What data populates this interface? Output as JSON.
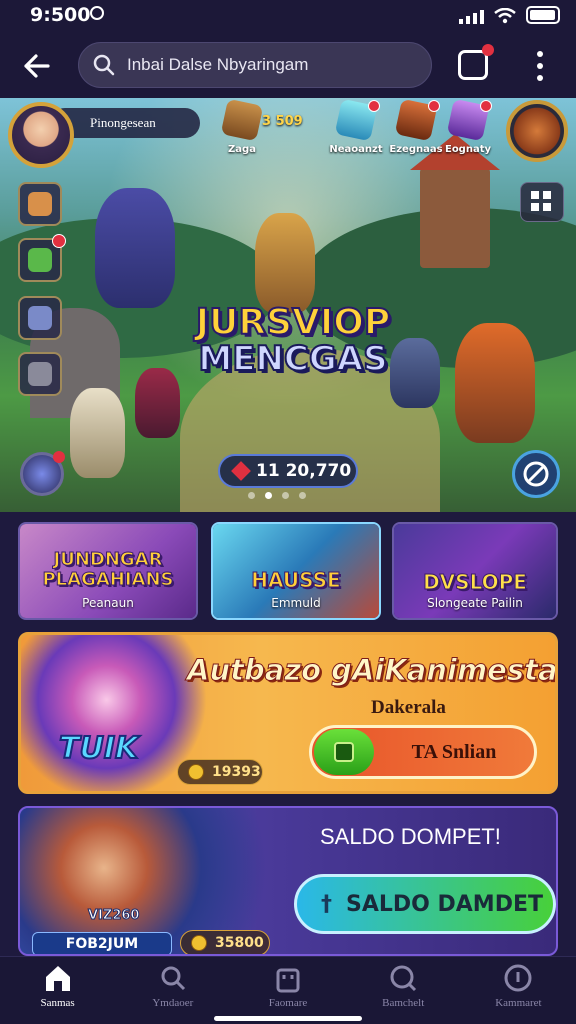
{
  "status": {
    "time": "9:500"
  },
  "search": {
    "value": "Inbai Dalse Nbyaringam"
  },
  "hero": {
    "player_name": "Pinongesean",
    "resources": [
      {
        "label": "Zaga",
        "value": "3 509"
      },
      {
        "label": "Neaoanzt"
      },
      {
        "label": "Ezegnaas"
      },
      {
        "label": "Eognaty"
      }
    ],
    "title_line1": "JURSVIOP",
    "title_line2": "MENCGAS",
    "counter": "11 20,770"
  },
  "tiles": [
    {
      "name": "JUNDNGAR PLAGAHIANS",
      "sub": "Peanaun"
    },
    {
      "name": "HAUSSE",
      "sub": "Emmuld"
    },
    {
      "name": "DVSLOPE",
      "sub": "Slongeate Pailin"
    }
  ],
  "promo": {
    "title": "Autbazo gAiKanimestail!",
    "subtitle": "Dakerala",
    "logo": "TUIK",
    "coins": "19393",
    "button": "TA Snlian"
  },
  "wallet": {
    "title": "SALDO DOMPET!",
    "button": "SALDO DAMDET",
    "tag": "FOB2JUM",
    "mini": "VIZ260",
    "coins": "35800"
  },
  "nav": [
    {
      "label": "Sanmas",
      "icon": "home-icon"
    },
    {
      "label": "Ymdaoer",
      "icon": "search-icon"
    },
    {
      "label": "Faomare",
      "icon": "bag-icon"
    },
    {
      "label": "Bamchelt",
      "icon": "magnifier-icon"
    },
    {
      "label": "Kammaret",
      "icon": "info-icon"
    }
  ],
  "colors": {
    "background": "#1e1a3e",
    "accent": "#e8a23a",
    "badge": "#e23040"
  }
}
